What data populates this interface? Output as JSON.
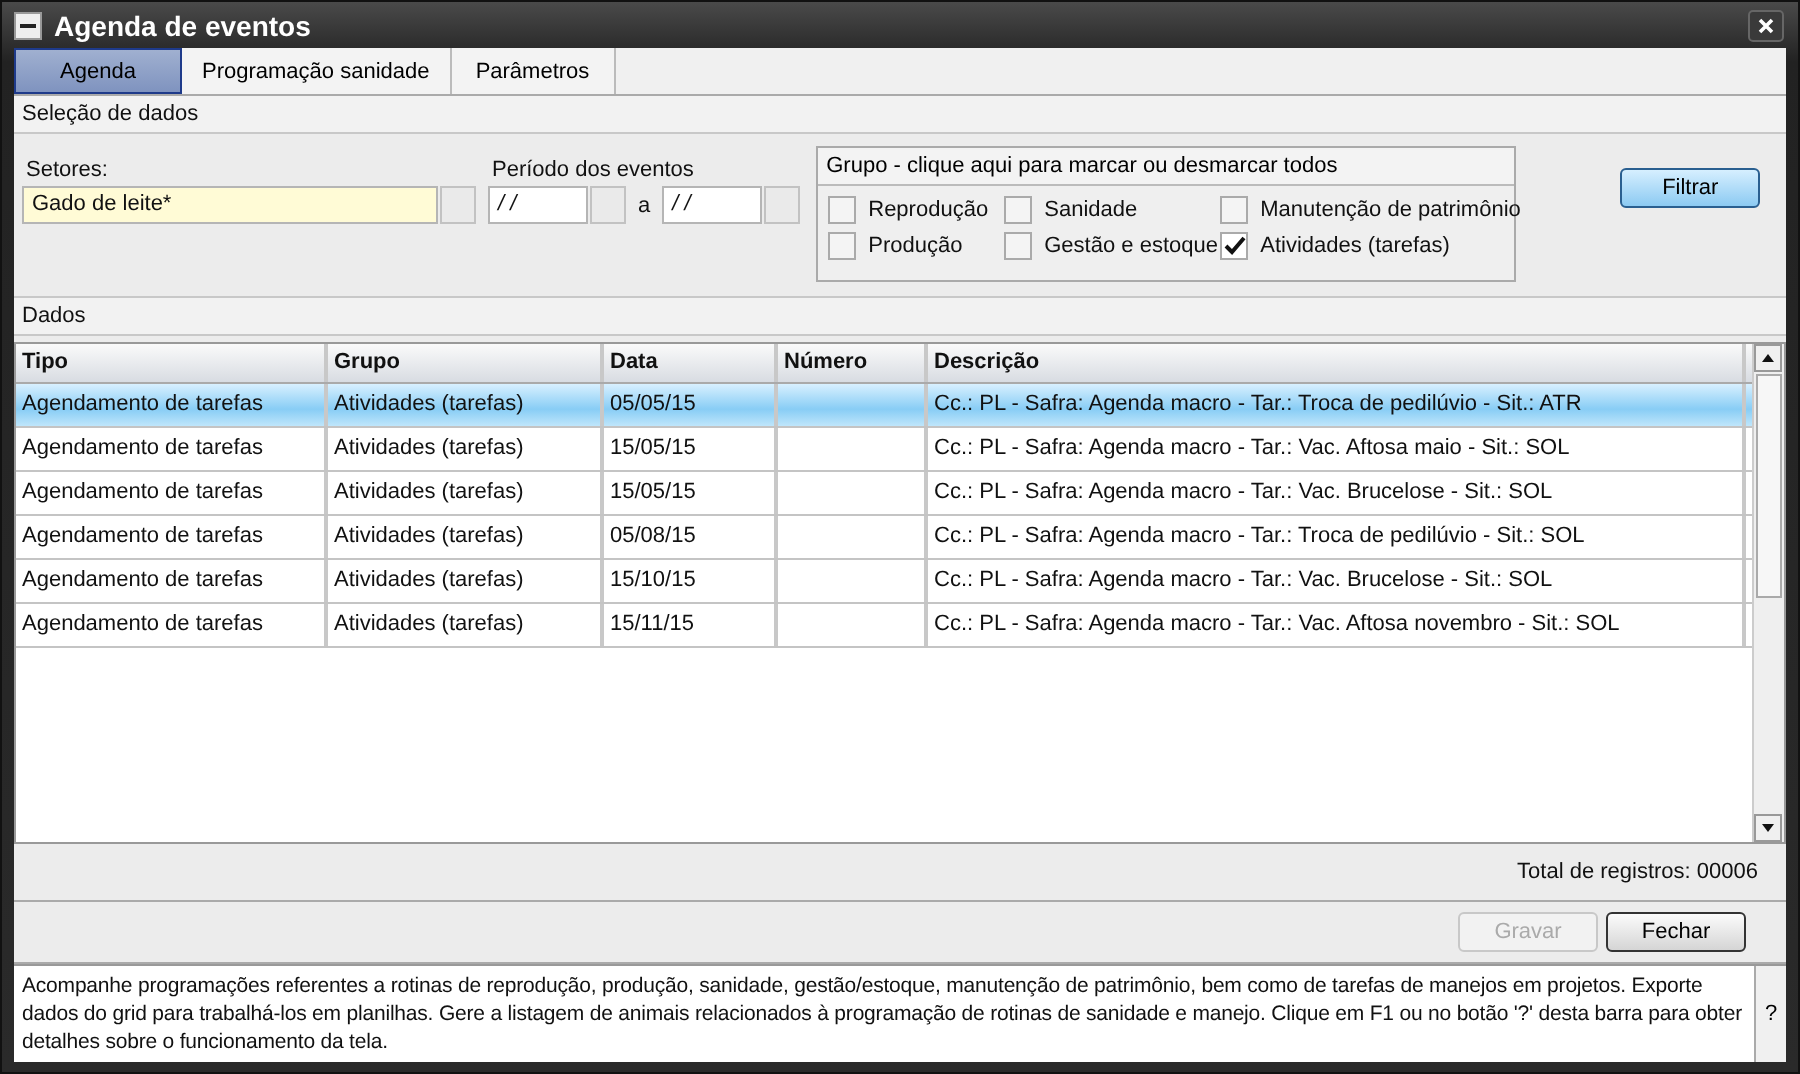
{
  "window": {
    "title": "Agenda de eventos"
  },
  "tabs": [
    {
      "label": "Agenda",
      "selected": true
    },
    {
      "label": "Programação sanidade",
      "selected": false
    },
    {
      "label": "Parâmetros",
      "selected": false
    }
  ],
  "selection_section": {
    "title": "Seleção de dados"
  },
  "sectors": {
    "label": "Setores:",
    "value": "Gado de leite*"
  },
  "period": {
    "label": "Período dos eventos",
    "from": "/ /",
    "separator": "a",
    "to": "/ /"
  },
  "group": {
    "title": "Grupo - clique aqui para marcar ou desmarcar todos",
    "options": [
      {
        "label": "Reprodução",
        "checked": false
      },
      {
        "label": "Sanidade",
        "checked": false
      },
      {
        "label": "Manutenção de patrimônio",
        "checked": false
      },
      {
        "label": "Produção",
        "checked": false
      },
      {
        "label": "Gestão e estoque",
        "checked": false
      },
      {
        "label": "Atividades (tarefas)",
        "checked": true
      }
    ]
  },
  "filter_button": "Filtrar",
  "data_section": {
    "title": "Dados"
  },
  "table": {
    "columns": [
      "Tipo",
      "Grupo",
      "Data",
      "Número",
      "Descrição"
    ],
    "rows": [
      {
        "selected": true,
        "cells": [
          "Agendamento de tarefas",
          "Atividades (tarefas)",
          "05/05/15",
          "",
          "Cc.: PL - Safra: Agenda macro - Tar.: Troca de pedilúvio - Sit.: ATR"
        ]
      },
      {
        "selected": false,
        "cells": [
          "Agendamento de tarefas",
          "Atividades (tarefas)",
          "15/05/15",
          "",
          "Cc.: PL - Safra: Agenda macro - Tar.: Vac. Aftosa maio - Sit.: SOL"
        ]
      },
      {
        "selected": false,
        "cells": [
          "Agendamento de tarefas",
          "Atividades (tarefas)",
          "15/05/15",
          "",
          "Cc.: PL - Safra: Agenda macro - Tar.: Vac. Brucelose - Sit.: SOL"
        ]
      },
      {
        "selected": false,
        "cells": [
          "Agendamento de tarefas",
          "Atividades (tarefas)",
          "05/08/15",
          "",
          "Cc.: PL - Safra: Agenda macro - Tar.: Troca de pedilúvio - Sit.: SOL"
        ]
      },
      {
        "selected": false,
        "cells": [
          "Agendamento de tarefas",
          "Atividades (tarefas)",
          "15/10/15",
          "",
          "Cc.: PL - Safra: Agenda macro - Tar.: Vac. Brucelose - Sit.: SOL"
        ]
      },
      {
        "selected": false,
        "cells": [
          "Agendamento de tarefas",
          "Atividades (tarefas)",
          "15/11/15",
          "",
          "Cc.: PL - Safra: Agenda macro - Tar.: Vac. Aftosa novembro - Sit.: SOL"
        ]
      }
    ]
  },
  "total": "Total de registros: 00006",
  "buttons": [
    {
      "label": "Gravar",
      "disabled": true
    },
    {
      "label": "Fechar",
      "disabled": false
    }
  ],
  "help": {
    "text": "Acompanhe programações referentes a rotinas de reprodução, produção, sanidade, gestão/estoque, manutenção de patrimônio, bem como de tarefas de manejos em projetos. Exporte dados do grid para trabalhá-los em planilhas. Gere a listagem de animais relacionados à programação de rotinas de sanidade e manejo. Clique em F1 ou no botão '?' desta barra para obter detalhes sobre o funcionamento da tela.",
    "button": "?"
  }
}
